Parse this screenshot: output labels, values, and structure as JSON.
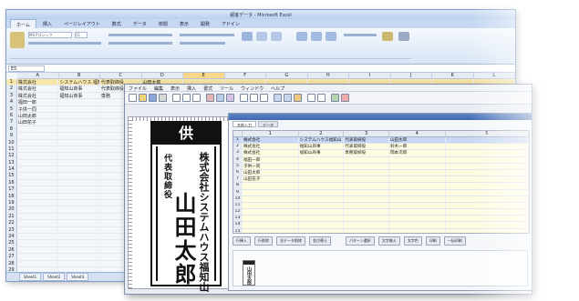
{
  "excel": {
    "title": "顧客データ - Microsoft Excel",
    "tabs": [
      "ホーム",
      "挿入",
      "ページレイアウト",
      "数式",
      "データ",
      "校閲",
      "表示",
      "開発",
      "アドイン"
    ],
    "font": "MS Pゴシック",
    "font_size": "11",
    "cell_ref": "E5",
    "columns": [
      "A",
      "B",
      "C",
      "D",
      "E",
      "F",
      "G",
      "H",
      "I",
      "J",
      "K",
      "L"
    ],
    "rows": [
      [
        "1",
        "株式会社",
        "システムハウス 福知山",
        "代表取締役",
        "山田太郎"
      ],
      [
        "2",
        "株式会社",
        "福知山商事",
        "代表取締役",
        "鈴木一郎"
      ],
      [
        "3",
        "株式会社",
        "福知山商事",
        "専務",
        "岡本次郎"
      ],
      [
        "4",
        "福田一郎",
        "",
        "",
        ""
      ],
      [
        "5",
        "子供一同",
        "",
        "",
        ""
      ],
      [
        "6",
        "山田太郎",
        "",
        "",
        ""
      ],
      [
        "7",
        "山田花子",
        "",
        "",
        ""
      ],
      [
        "8",
        "",
        "",
        "",
        ""
      ],
      [
        "9",
        "",
        "",
        "",
        ""
      ],
      [
        "10",
        "",
        "",
        "",
        ""
      ],
      [
        "11",
        "",
        "",
        "",
        ""
      ],
      [
        "12",
        "",
        "",
        "",
        ""
      ],
      [
        "13",
        "",
        "",
        "",
        ""
      ],
      [
        "14",
        "",
        "",
        "",
        ""
      ],
      [
        "15",
        "",
        "",
        "",
        ""
      ],
      [
        "16",
        "",
        "",
        "",
        ""
      ],
      [
        "17",
        "",
        "",
        "",
        ""
      ],
      [
        "18",
        "",
        "",
        "",
        ""
      ],
      [
        "19",
        "",
        "",
        "",
        ""
      ],
      [
        "20",
        "",
        "",
        "",
        ""
      ],
      [
        "21",
        "",
        "",
        "",
        ""
      ],
      [
        "22",
        "",
        "",
        "",
        ""
      ],
      [
        "23",
        "",
        "",
        "",
        ""
      ],
      [
        "24",
        "",
        "",
        "",
        ""
      ],
      [
        "25",
        "",
        "",
        "",
        ""
      ],
      [
        "26",
        "",
        "",
        "",
        ""
      ],
      [
        "27",
        "",
        "",
        "",
        ""
      ],
      [
        "28",
        "",
        "",
        "",
        ""
      ],
      [
        "29",
        "",
        "",
        "",
        ""
      ]
    ],
    "sheets": [
      "Sheet1",
      "Sheet2",
      "Sheet3"
    ]
  },
  "app": {
    "menu": [
      "ファイル",
      "編集",
      "表示",
      "挿入",
      "書式",
      "ツール",
      "ウィンドウ",
      "ヘルプ"
    ],
    "label": {
      "cap": "供",
      "company": "株式会社システムハウス福知山",
      "title": "代表取締役",
      "name": "山田太郎"
    },
    "grid": {
      "headers": [
        "",
        "1",
        "2",
        "3",
        "4",
        "5"
      ],
      "rows": [
        [
          "1",
          "株式会社",
          "システムハウス福知山",
          "代表取締役",
          "山田太郎",
          ""
        ],
        [
          "2",
          "株式会社",
          "福知山商事",
          "代表取締役",
          "鈴木一郎",
          ""
        ],
        [
          "3",
          "株式会社",
          "福知山商事",
          "専務取締役",
          "岡本次郎",
          ""
        ],
        [
          "4",
          "福田一郎",
          "",
          "",
          "",
          ""
        ],
        [
          "5",
          "子供一同",
          "",
          "",
          "",
          ""
        ],
        [
          "6",
          "山田太郎",
          "",
          "",
          "",
          ""
        ],
        [
          "7",
          "山田花子",
          "",
          "",
          "",
          ""
        ],
        [
          "8",
          "",
          "",
          "",
          "",
          ""
        ],
        [
          "9",
          "",
          "",
          "",
          "",
          ""
        ],
        [
          "10",
          "",
          "",
          "",
          "",
          ""
        ],
        [
          "11",
          "",
          "",
          "",
          "",
          ""
        ],
        [
          "12",
          "",
          "",
          "",
          "",
          ""
        ],
        [
          "13",
          "",
          "",
          "",
          "",
          ""
        ],
        [
          "14",
          "",
          "",
          "",
          "",
          ""
        ],
        [
          "15",
          "",
          "",
          "",
          "",
          ""
        ]
      ]
    },
    "pane_tabs": [
      "名前入力",
      "データ"
    ],
    "pane_buttons": [
      "行挿入",
      "行削除",
      "全データ削除",
      "並び替え",
      "パターン選択",
      "文字揃え",
      "文字色",
      "印刷",
      "一括印刷"
    ],
    "thumb_text": "山田太郎"
  }
}
